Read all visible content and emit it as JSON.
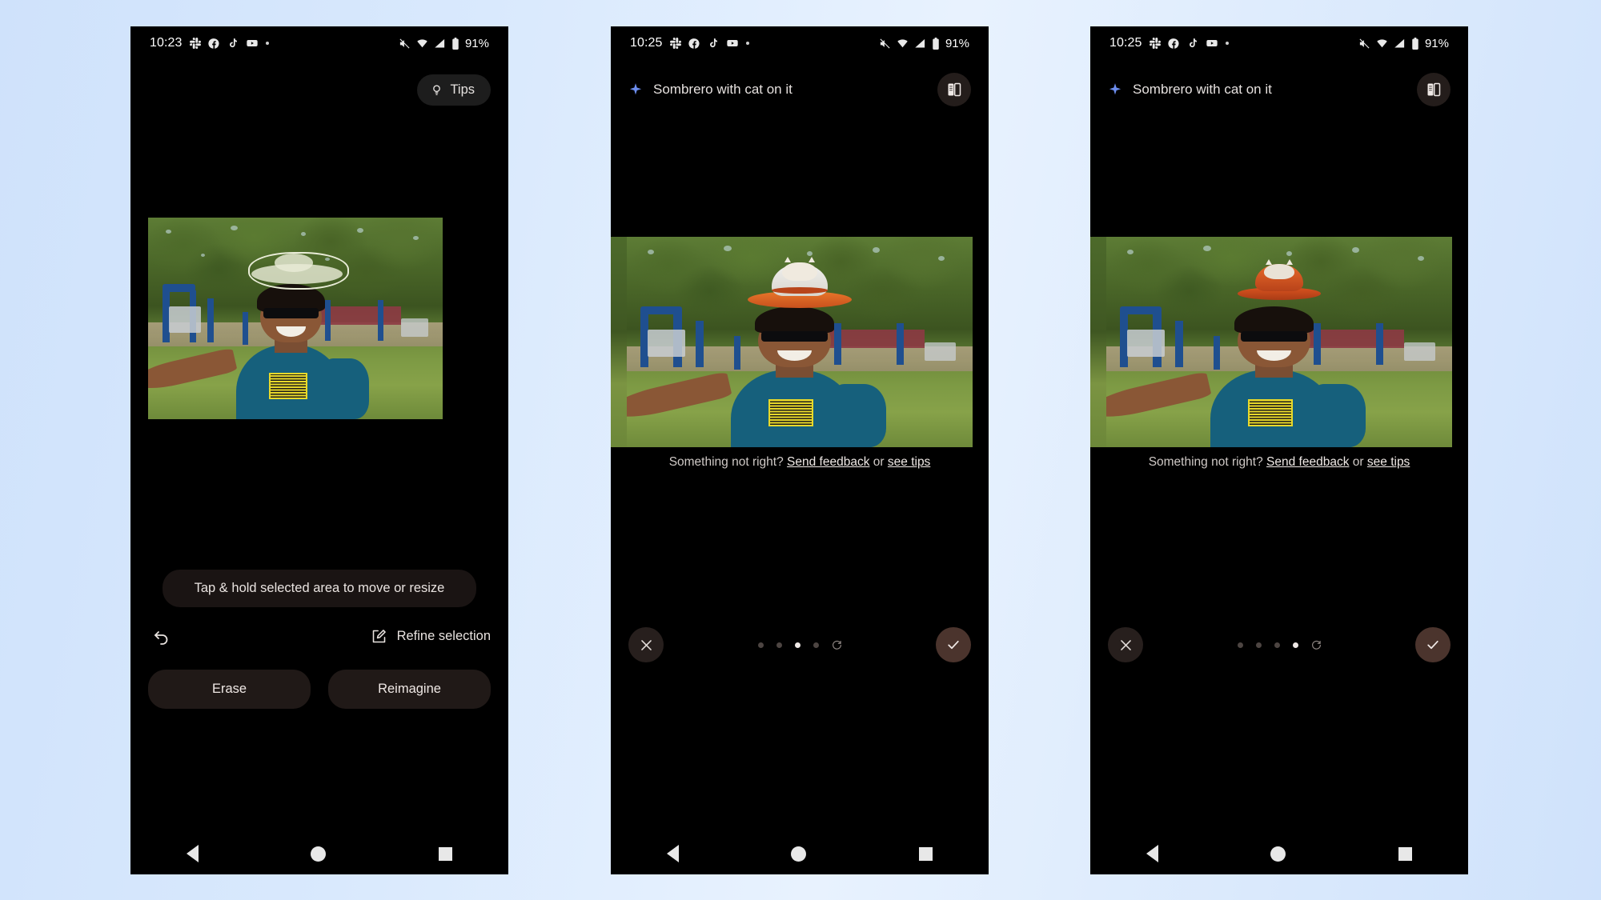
{
  "phones": [
    {
      "id": "phone-selection",
      "status": {
        "time": "10:23",
        "battery": "91%",
        "icons": [
          "slack-icon",
          "facebook-icon",
          "tiktok-icon",
          "youtube-icon",
          "more-dot-icon",
          "mute-icon",
          "wifi-icon",
          "signal-icon",
          "battery-icon"
        ]
      },
      "header": {
        "tips_label": "Tips",
        "tips_icon": "lightbulb-icon"
      },
      "hint": "Tap & hold selected area to move or resize",
      "tools": {
        "undo_icon": "undo-icon",
        "refine_icon": "edit-square-icon",
        "refine_label": "Refine selection"
      },
      "actions": [
        "Erase",
        "Reimagine"
      ],
      "nav": [
        "back-triangle-icon",
        "home-circle-icon",
        "recents-square-icon"
      ]
    },
    {
      "id": "phone-result-3",
      "status": {
        "time": "10:25",
        "battery": "91%"
      },
      "header": {
        "prompt": "Sombrero with cat on it",
        "sparkle_icon": "sparkle-icon",
        "compare_icon": "compare-split-icon"
      },
      "feedback": {
        "prefix": "Something not right?",
        "link1": "Send feedback",
        "middle": "or",
        "link2": "see tips"
      },
      "carousel": {
        "close_icon": "close-x-icon",
        "confirm_icon": "check-icon",
        "dot_count": 4,
        "active_dot": 3,
        "reload_icon": "reload-icon"
      },
      "nav": [
        "back-triangle-icon",
        "home-circle-icon",
        "recents-square-icon"
      ]
    },
    {
      "id": "phone-result-4",
      "status": {
        "time": "10:25",
        "battery": "91%"
      },
      "header": {
        "prompt": "Sombrero with cat on it",
        "sparkle_icon": "sparkle-icon",
        "compare_icon": "compare-split-icon"
      },
      "feedback": {
        "prefix": "Something not right?",
        "link1": "Send feedback",
        "middle": "or",
        "link2": "see tips"
      },
      "carousel": {
        "close_icon": "close-x-icon",
        "confirm_icon": "check-icon",
        "dot_count": 4,
        "active_dot": 4,
        "reload_icon": "reload-icon"
      },
      "nav": [
        "back-triangle-icon",
        "home-circle-icon",
        "recents-square-icon"
      ]
    }
  ],
  "colors": {
    "background_gradient_start": "#cfe2fb",
    "background_gradient_end": "#e8f2fe",
    "phone_bg": "#000000",
    "pill_bg": "#201917",
    "accent_confirm": "#4b342d",
    "sparkle_blue": "#6d8ef0",
    "text_primary": "#efe9e6"
  }
}
